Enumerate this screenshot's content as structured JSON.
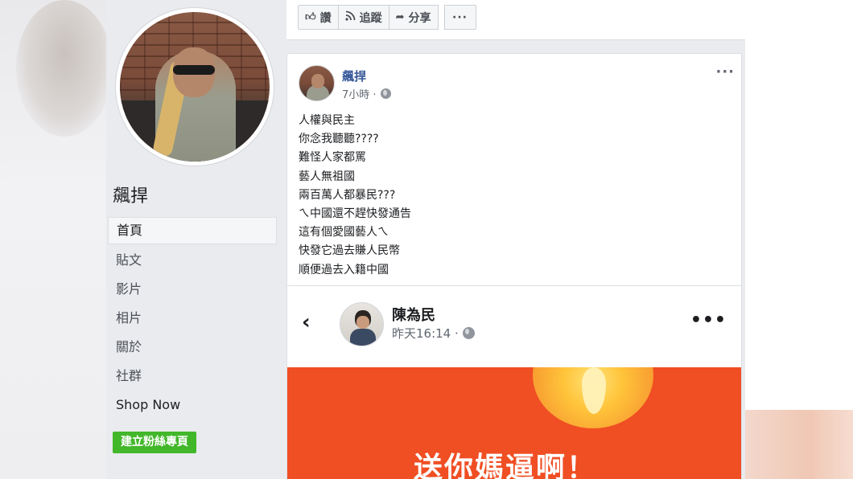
{
  "page": {
    "name": "飆捍"
  },
  "nav": {
    "items": [
      "首頁",
      "貼文",
      "影片",
      "相片",
      "關於",
      "社群",
      "Shop Now"
    ]
  },
  "create_page_button": "建立粉絲專頁",
  "action_bar": {
    "like": "讚",
    "follow": "追蹤",
    "share": "分享",
    "more": "···"
  },
  "post": {
    "author": "飆捍",
    "time": "7小時 ·",
    "menu": "···",
    "lines": [
      "人權與民主",
      "你念我聽聽????",
      "難怪人家都罵",
      "藝人無祖國",
      "兩百萬人都暴民???",
      "ㄟ中國還不趕快發通告",
      "這有個愛國藝人ㄟ",
      "快發它過去賺人民幣",
      "順便過去入籍中國"
    ],
    "shared": {
      "back": "‹",
      "name": "陳為民",
      "time": "昨天16:14 ·",
      "menu": "•••",
      "image_text": "送你媽逼啊！"
    }
  },
  "colors": {
    "link_blue": "#365899",
    "green": "#42b72a",
    "orange": "#f04e23"
  }
}
